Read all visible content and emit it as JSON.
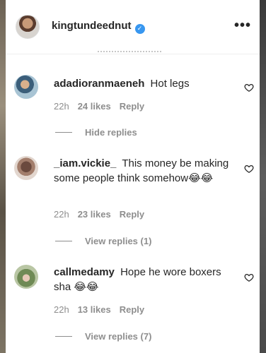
{
  "header": {
    "username": "kingtundeednut",
    "verified_mark": "✓",
    "more_label": "•••"
  },
  "comments": [
    {
      "username": "adadioranmaeneh",
      "text": "Hot legs",
      "time": "22h",
      "likes": "24 likes",
      "reply_label": "Reply",
      "replies_toggle": "Hide replies"
    },
    {
      "username": "_iam.vickie_",
      "text": "This money be making some people think somehow😂😂",
      "time": "22h",
      "likes": "23 likes",
      "reply_label": "Reply",
      "replies_toggle": "View replies (1)"
    },
    {
      "username": "callmedamy",
      "text": "Hope he wore boxers sha 😂😂",
      "time": "22h",
      "likes": "13 likes",
      "reply_label": "Reply",
      "replies_toggle": "View replies (7)"
    }
  ],
  "icons": {
    "heart": "heart-outline-icon",
    "more": "more-horizontal-icon",
    "verified": "verified-badge-icon"
  }
}
